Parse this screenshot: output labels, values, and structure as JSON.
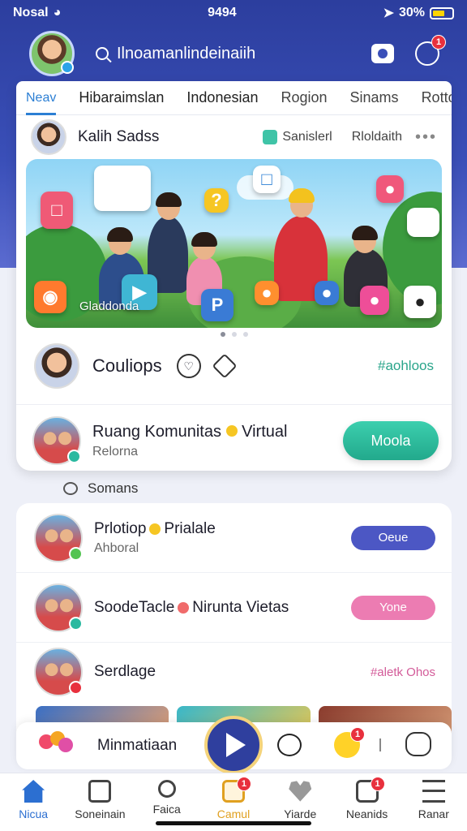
{
  "status": {
    "carrier": "Nosal",
    "time": "9494",
    "battery_pct": "30%"
  },
  "header": {
    "search_text": "Ilnoamanlindeinaiih",
    "notifications_badge": "1"
  },
  "tabs": [
    {
      "label": "Neav"
    },
    {
      "label": "Hibaraimslan"
    },
    {
      "label": "Indonesian"
    },
    {
      "label": "Rogion"
    },
    {
      "label": "Sinams"
    },
    {
      "label": "Rottord"
    }
  ],
  "post": {
    "author": "Kalih Sadss",
    "chip1": "Sanislerl",
    "chip2": "Rloldaith",
    "hero_caption": "Gladdonda",
    "action_label": "Couliops",
    "hashtag": "#aohloos",
    "pager": {
      "total": 3,
      "active": 0
    }
  },
  "community": {
    "title": "Ruang Komunitas",
    "title2": "Virtual",
    "subtitle": "Relorna",
    "button": "Moola"
  },
  "section": {
    "label": "Somans"
  },
  "list": [
    {
      "title": "Prlotiop",
      "title2": "Prialale",
      "subtitle": "Ahboral",
      "button": "Oeue"
    },
    {
      "title": "SoodeTacle",
      "title2": "Nirunta Vietas",
      "subtitle": "",
      "button": "Yone"
    },
    {
      "title": "Serdlage",
      "subtitle": "",
      "hashtag": "#aletk Ohos"
    }
  ],
  "action_bar": {
    "label": "Minmatiaan",
    "badge": "1"
  },
  "nav": [
    {
      "label": "Nicua",
      "icon": "home-icon"
    },
    {
      "label": "Soneinain",
      "icon": "box-icon"
    },
    {
      "label": "Faica",
      "icon": "search-icon"
    },
    {
      "label": "Camul",
      "icon": "bag-icon",
      "badge": "1"
    },
    {
      "label": "Yiarde",
      "icon": "heart-icon"
    },
    {
      "label": "Neanids",
      "icon": "camera-icon",
      "badge": "1"
    },
    {
      "label": "Ranar",
      "icon": "menu-icon"
    }
  ],
  "colors": {
    "header": "#2c3e9e",
    "accent": "#2c7fd4",
    "teal": "#22a98c",
    "pill_blue": "#4c57c4",
    "pill_pink": "#ec7cb2"
  }
}
